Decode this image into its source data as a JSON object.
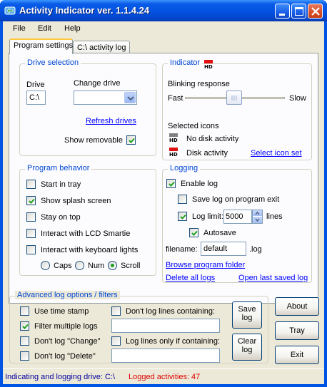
{
  "window": {
    "title": "Activity Indicator ver. 1.1.4.24"
  },
  "menu": [
    "File",
    "Edit",
    "Help"
  ],
  "tabs": [
    "Program settings",
    "C:\\ activity log"
  ],
  "drive_selection": {
    "title": "Drive selection",
    "drive_label": "Drive",
    "drive_value": "C:\\",
    "change_drive_label": "Change drive",
    "refresh_label": "Refresh drives",
    "show_removable_label": "Show removable",
    "show_removable_checked": true
  },
  "indicator": {
    "title": "Indicator",
    "blinking_label": "Blinking response",
    "fast_label": "Fast",
    "slow_label": "Slow",
    "blink_level": 0.5,
    "selected_icons_label": "Selected icons",
    "no_activity_label": "No disk activity",
    "disk_activity_label": "Disk activity",
    "select_icon_set_label": "Select icon set",
    "icon_text": "HD",
    "idle_color": "#808080",
    "active_color": "#e01010"
  },
  "program_behavior": {
    "title": "Program behavior",
    "options": [
      {
        "label": "Start in tray",
        "checked": false
      },
      {
        "label": "Show splash screen",
        "checked": true
      },
      {
        "label": "Stay on top",
        "checked": false
      },
      {
        "label": "Interact with LCD Smartie",
        "checked": false
      },
      {
        "label": "Interact with keyboard lights",
        "checked": false
      }
    ],
    "radios": [
      {
        "label": "Caps",
        "selected": false
      },
      {
        "label": "Num",
        "selected": false
      },
      {
        "label": "Scroll",
        "selected": true
      }
    ]
  },
  "logging": {
    "title": "Logging",
    "enable_label": "Enable log",
    "enable_checked": true,
    "save_on_exit_label": "Save log on program exit",
    "save_on_exit_checked": false,
    "log_limit_label": "Log limit:",
    "log_limit_checked": true,
    "log_limit_value": "5000",
    "lines_label": "lines",
    "autosave_label": "Autosave",
    "autosave_checked": true,
    "filename_label": "filename:",
    "filename_value": "default",
    "extension_label": ".log",
    "browse_label": "Browse program folder",
    "delete_label": "Delete all logs",
    "open_label": "Open last saved log"
  },
  "advanced": {
    "title": "Advanced log options / filters",
    "options": [
      {
        "label": "Use time stamp",
        "checked": false
      },
      {
        "label": "Filter multiple logs",
        "checked": true
      },
      {
        "label": "Don't log \"Change\"",
        "checked": false
      },
      {
        "label": "Don't log \"Delete\"",
        "checked": false
      }
    ],
    "dont_log_containing_label": "Don't log lines containing:",
    "dont_log_containing_checked": false,
    "dont_log_containing_value": "",
    "log_only_containing_label": "Log lines only if containing:",
    "log_only_containing_checked": false,
    "log_only_containing_value": "",
    "save_log_label": [
      "Save",
      "log"
    ],
    "clear_log_label": [
      "Clear",
      "log"
    ]
  },
  "buttons": {
    "about": "About",
    "tray": "Tray",
    "exit": "Exit"
  },
  "status": {
    "left": "Indicating and logging  drive: C:\\",
    "right": "Logged activities: 47",
    "left_color": "#0000a0",
    "right_color": "#e00000"
  }
}
